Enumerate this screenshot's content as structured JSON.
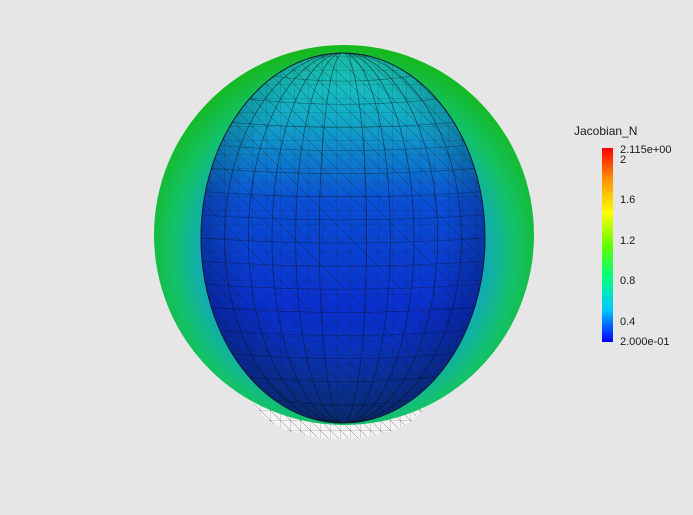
{
  "viewport": {
    "background": "#e6e6e6"
  },
  "scalar_bar": {
    "title": "Jacobian_N",
    "max_label": "2.115e+00",
    "min_label": "2.000e-01",
    "range": [
      0.2,
      2.115
    ],
    "ticks": [
      {
        "value": 2.0,
        "label": "2"
      },
      {
        "value": 1.6,
        "label": "1.6"
      },
      {
        "value": 1.2,
        "label": "1.2"
      },
      {
        "value": 0.8,
        "label": "0.8"
      },
      {
        "value": 0.4,
        "label": "0.4"
      }
    ],
    "colormap": [
      "#0000ff",
      "#00c8ff",
      "#00ff80",
      "#64ff00",
      "#ffff00",
      "#ff9600",
      "#ff0000"
    ]
  },
  "scene": {
    "outer_sphere_edge_color": "#10c21a",
    "inner_mesh_center_color": "#0a3ad6",
    "inner_mesh_top_color": "#1ad0c0",
    "wireframe_color": "#202020",
    "bottom_cap_color": "#f2f2f2"
  }
}
